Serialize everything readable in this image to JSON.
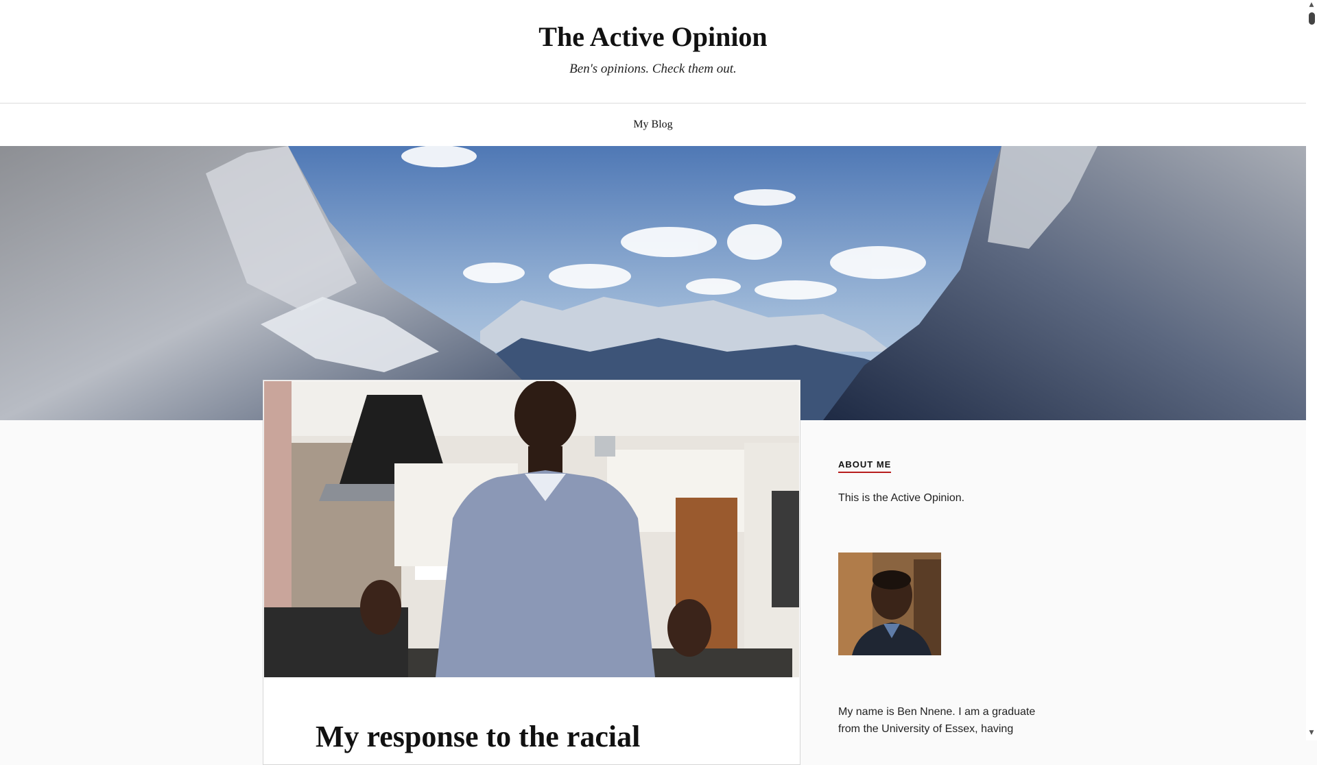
{
  "site": {
    "title": "The Active Opinion",
    "tagline": "Ben's opinions. Check them out."
  },
  "nav": {
    "items": [
      {
        "label": "My Blog"
      }
    ]
  },
  "post": {
    "title": "My response to the racial"
  },
  "sidebar": {
    "about_heading": "ABOUT ME",
    "about_text": "This is the Active Opinion.",
    "bio_text": "My name is Ben Nnene. I am a graduate from the University of Essex, having"
  },
  "colors": {
    "accent_underline": "#b71c1c",
    "header_background": "#ffffff",
    "page_background": "#fafafa"
  },
  "icons": {
    "scroll_up": "scroll-up-arrow-icon",
    "scroll_down": "scroll-down-arrow-icon"
  }
}
